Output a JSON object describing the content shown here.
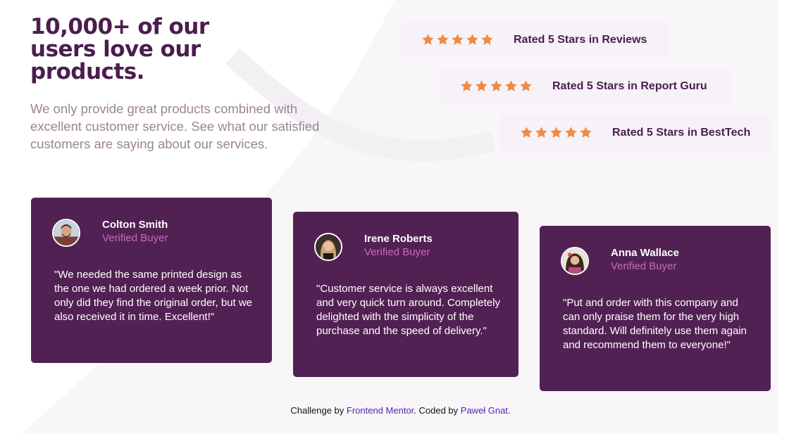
{
  "header": {
    "headline": "10,000+ of our users love our products.",
    "intro": "We only provide great products combined with excellent customer service. See what our satisfied customers are saying about our services."
  },
  "ratings": [
    {
      "label": "Rated 5 Stars in Reviews",
      "stars": 5
    },
    {
      "label": "Rated 5 Stars in Report Guru",
      "stars": 5
    },
    {
      "label": "Rated 5 Stars in BestTech",
      "stars": 5
    }
  ],
  "testimonials": [
    {
      "name": "Colton Smith",
      "status": "Verified Buyer",
      "quote": "\"We needed the same printed design as the one we had ordered a week prior. Not only did they find the original order, but we also received it in time. Excellent!\""
    },
    {
      "name": "Irene Roberts",
      "status": "Verified Buyer",
      "quote": "\"Customer service is always excellent and very quick turn around. Completely delighted with the simplicity of the purchase and the speed of delivery.\""
    },
    {
      "name": "Anna Wallace",
      "status": "Verified Buyer",
      "quote": "\"Put and order with this company and can only praise them for the very high standard. Will definitely use them again and recommend them to everyone!\""
    }
  ],
  "footer": {
    "prefix": "Challenge by ",
    "challenge_link": "Frontend Mentor",
    "middle": ". Coded by ",
    "author_link": "Paweł Gnat",
    "suffix": "."
  },
  "colors": {
    "primary": "#4b1d4f",
    "card_bg": "#522153",
    "verified": "#c56bb8",
    "star": "#ee8b45",
    "rating_bg": "#f7f2f8",
    "muted_text": "#9a8498",
    "link": "#4b2bad"
  },
  "icons": {
    "star": "star-icon"
  }
}
